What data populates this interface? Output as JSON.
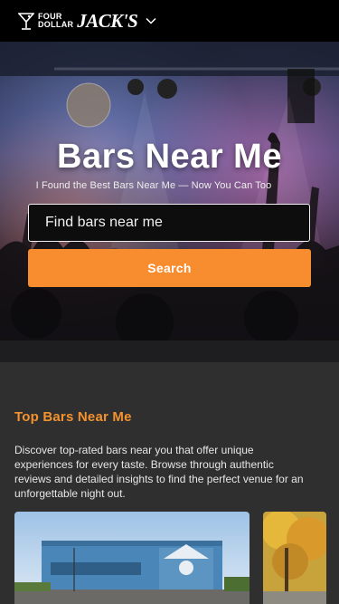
{
  "header": {
    "logo_small_top": "FOUR",
    "logo_small_bottom": "DOLLAR",
    "logo_big": "JACK'S",
    "menu_icon": "chevron-down-icon"
  },
  "hero": {
    "title": "Bars Near Me",
    "subtitle": "I Found the Best Bars Near Me — Now You Can Too",
    "search_placeholder": "Find bars near me",
    "search_value": "",
    "search_button_label": "Search"
  },
  "top_bars": {
    "title": "Top Bars Near Me",
    "description": "Discover top-rated bars near you that offer unique experiences for every taste. Browse through authentic reviews and detailed insights to find the perfect venue for an unforgettable night out.",
    "accent_color": "#f3922f"
  },
  "colors": {
    "topbar_bg": "#000000",
    "page_bg": "#2f2f2f",
    "search_button_bg": "#f78d2e"
  }
}
